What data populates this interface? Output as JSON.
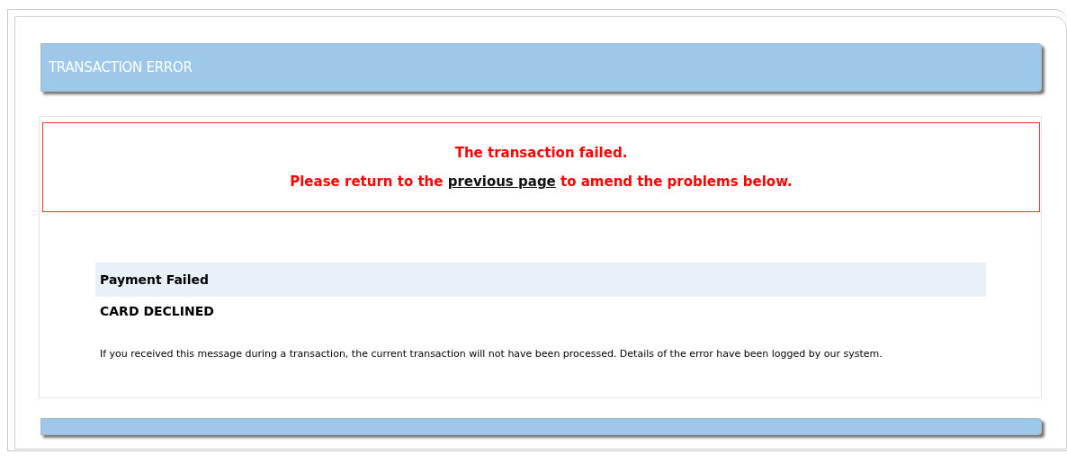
{
  "header": {
    "title": "TRANSACTION ERROR"
  },
  "error": {
    "headline": "The transaction failed.",
    "before_link": "Please return to the",
    "link": "previous page",
    "after_link": "to amend the problems below."
  },
  "result": {
    "heading": "Payment Failed",
    "status": "CARD DECLINED",
    "note": "If you received this message during a transaction, the current transaction will not have been processed. Details of the error have been logged by our system."
  }
}
